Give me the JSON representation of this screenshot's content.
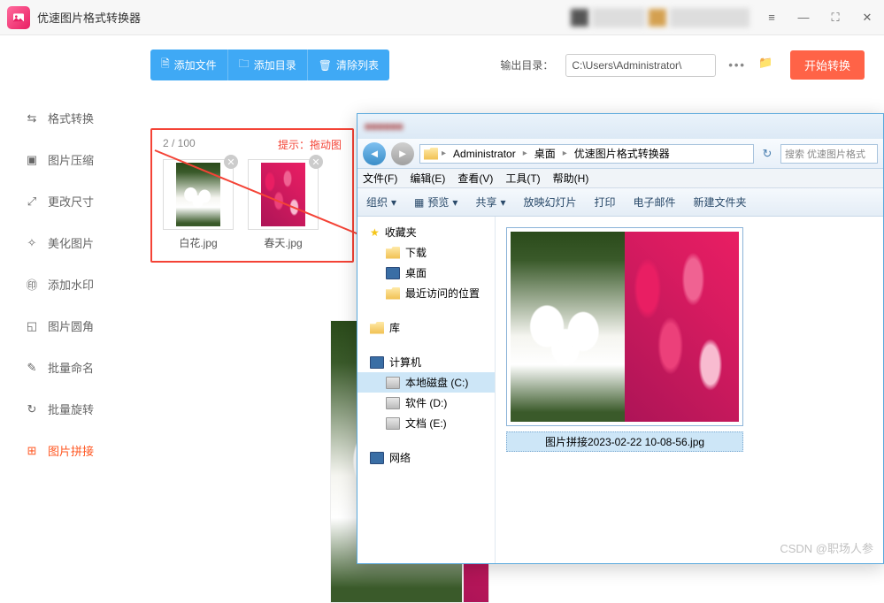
{
  "app": {
    "title": "优速图片格式转换器"
  },
  "toolbar": {
    "add_file": "添加文件",
    "add_dir": "添加目录",
    "clear_list": "清除列表",
    "output_label": "输出目录：",
    "output_path": "C:\\Users\\Administrator\\",
    "start": "开始转换"
  },
  "sidebar": [
    {
      "label": "格式转换"
    },
    {
      "label": "图片压缩"
    },
    {
      "label": "更改尺寸"
    },
    {
      "label": "美化图片"
    },
    {
      "label": "添加水印"
    },
    {
      "label": "图片圆角"
    },
    {
      "label": "批量命名"
    },
    {
      "label": "批量旋转"
    },
    {
      "label": "图片拼接"
    }
  ],
  "panel": {
    "count": "2 / 100",
    "hint": "提示：拖动图",
    "thumbs": [
      "白花.jpg",
      "春天.jpg"
    ]
  },
  "explorer": {
    "breadcrumb": [
      "Administrator",
      "桌面",
      "优速图片格式转换器"
    ],
    "search_placeholder": "搜索 优速图片格式",
    "menus": [
      "文件(F)",
      "编辑(E)",
      "查看(V)",
      "工具(T)",
      "帮助(H)"
    ],
    "commands": [
      "组织",
      "预览",
      "共享",
      "放映幻灯片",
      "打印",
      "电子邮件",
      "新建文件夹"
    ],
    "tree": {
      "favorites": {
        "title": "收藏夹",
        "items": [
          "下载",
          "桌面",
          "最近访问的位置"
        ]
      },
      "library": {
        "title": "库"
      },
      "computer": {
        "title": "计算机",
        "items": [
          "本地磁盘 (C:)",
          "软件 (D:)",
          "文档 (E:)"
        ]
      },
      "network": {
        "title": "网络"
      }
    },
    "file": {
      "name": "图片拼接2023-02-22 10-08-56.jpg"
    }
  },
  "watermark": "CSDN @职场人参"
}
